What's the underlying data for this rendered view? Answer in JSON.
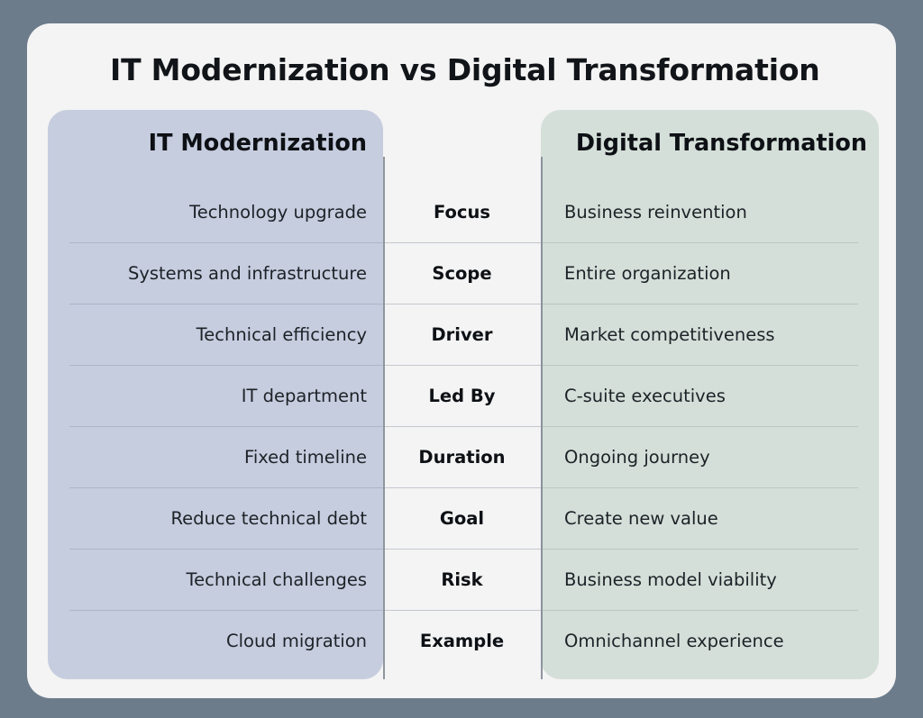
{
  "page": {
    "title": "IT Modernization vs Digital Transformation",
    "background_color": "#6c7c8b",
    "card_color": "#f4f4f4"
  },
  "colors": {
    "left_panel": "#c6cddf",
    "right_panel": "#d4dfd9",
    "middle_column": "#fafafa",
    "divider": "#7d8590",
    "text": "#1d2227"
  },
  "table": {
    "left_column_header": "IT Modernization",
    "right_column_header": "Digital Transformation",
    "rows": [
      {
        "attribute": "Focus",
        "left": "Technology upgrade",
        "right": "Business reinvention"
      },
      {
        "attribute": "Scope",
        "left": "Systems and infrastructure",
        "right": "Entire organization"
      },
      {
        "attribute": "Driver",
        "left": "Technical efficiency",
        "right": "Market competitiveness"
      },
      {
        "attribute": "Led By",
        "left": "IT department",
        "right": "C-suite executives"
      },
      {
        "attribute": "Duration",
        "left": "Fixed timeline",
        "right": "Ongoing journey"
      },
      {
        "attribute": "Goal",
        "left": "Reduce technical debt",
        "right": "Create new value"
      },
      {
        "attribute": "Risk",
        "left": "Technical challenges",
        "right": "Business model viability"
      },
      {
        "attribute": "Example",
        "left": "Cloud migration",
        "right": "Omnichannel experience"
      }
    ]
  }
}
